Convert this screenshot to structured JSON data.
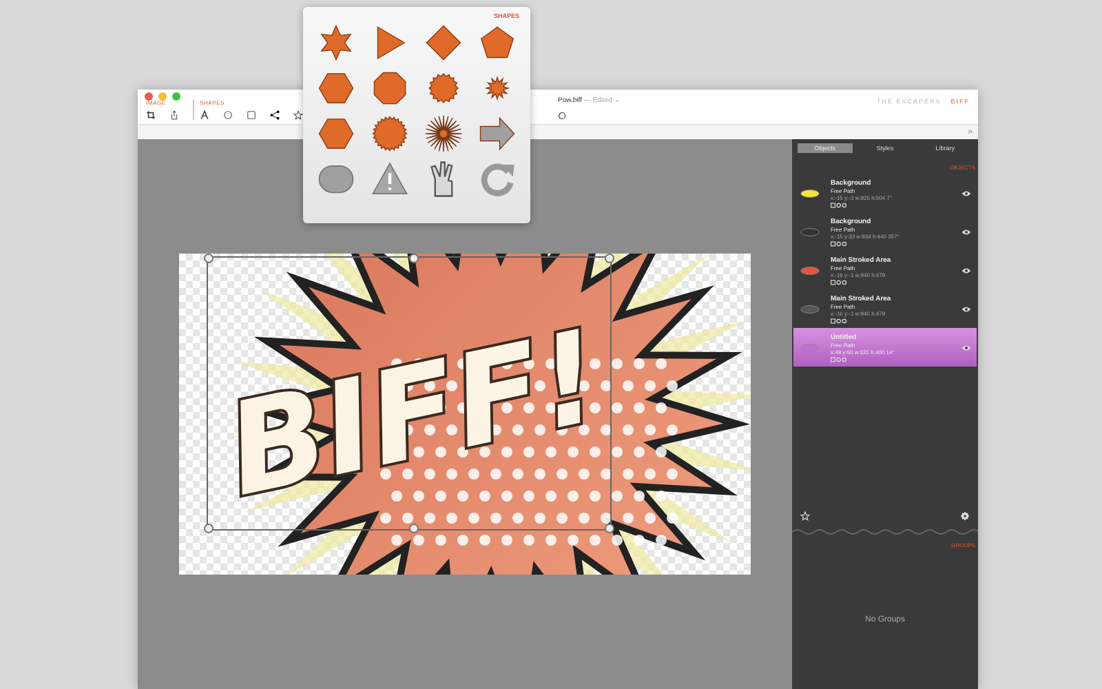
{
  "window": {
    "title": "Pow.biff",
    "status": "— Edited ⌄",
    "brand": "THE ESCAPERS ·",
    "brand_app": "BIFF"
  },
  "toolbar": {
    "groups": [
      {
        "label": "IMAGE"
      },
      {
        "label": "SHAPES"
      }
    ],
    "expand": "»"
  },
  "shapes_popover": {
    "title": "SHAPES"
  },
  "canvas": {
    "artwork_text": "BIFF!"
  },
  "sidebar": {
    "tabs": [
      {
        "label": "Objects",
        "selected": true
      },
      {
        "label": "Styles",
        "selected": false
      },
      {
        "label": "Library",
        "selected": false
      }
    ],
    "objects_header": "OBJECTS",
    "objects": [
      {
        "name": "Background",
        "type": "Free Path",
        "geometry": "x:-15 y:-3 w:926 h:504 7°",
        "color": "#f2e63a",
        "selected": false
      },
      {
        "name": "Background",
        "type": "Free Path",
        "geometry": "x:-15 y:33 w:934 h:440 357°",
        "color": "#333333",
        "selected": false
      },
      {
        "name": "Main Stroked Area",
        "type": "Free Path",
        "geometry": "x:-16 y:-1 w:940 h:479",
        "color": "#e8543a",
        "selected": false
      },
      {
        "name": "Main Stroked Area",
        "type": "Free Path",
        "geometry": "x:-16 y:-1 w:940 h:479",
        "color": "#555555",
        "selected": false
      },
      {
        "name": "Untitled",
        "type": "Free Path",
        "geometry": "x:48 y:60 w:621 h:400 14°",
        "color": "#c070d0",
        "selected": true
      }
    ],
    "groups_header": "GROUPS",
    "groups_empty": "No Groups"
  }
}
